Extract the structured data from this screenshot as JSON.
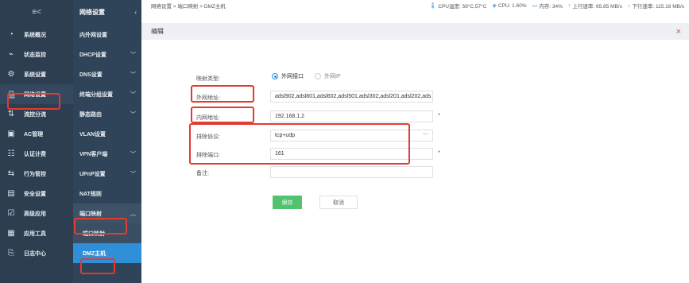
{
  "sidebar": {
    "collapse_icon": "≡<",
    "items": [
      {
        "icon": "dashboard-icon",
        "glyph": "◔",
        "label": "系统概况"
      },
      {
        "icon": "monitor-icon",
        "glyph": "⌁",
        "label": "状态监控"
      },
      {
        "icon": "gear-icon",
        "glyph": "⚙",
        "label": "系统设置"
      },
      {
        "icon": "network-icon",
        "glyph": "品",
        "label": "网络设置"
      },
      {
        "icon": "traffic-split-icon",
        "glyph": "⇅",
        "label": "流控分流"
      },
      {
        "icon": "ac-icon",
        "glyph": "▣",
        "label": "AC管理"
      },
      {
        "icon": "auth-icon",
        "glyph": "☷",
        "label": "认证计费"
      },
      {
        "icon": "behavior-icon",
        "glyph": "⇆",
        "label": "行为管控"
      },
      {
        "icon": "security-icon",
        "glyph": "▤",
        "label": "安全设置"
      },
      {
        "icon": "advanced-icon",
        "glyph": "☑",
        "label": "高级应用"
      },
      {
        "icon": "tools-icon",
        "glyph": "▦",
        "label": "应用工具"
      },
      {
        "icon": "log-icon",
        "glyph": "⎘",
        "label": "日志中心"
      }
    ]
  },
  "subbar": {
    "title": "网络设置",
    "items": [
      {
        "label": "内外网设置",
        "chevron": ""
      },
      {
        "label": "DHCP设置",
        "chevron": "﹀"
      },
      {
        "label": "DNS设置",
        "chevron": "﹀"
      },
      {
        "label": "终端分组设置",
        "chevron": "﹀"
      },
      {
        "label": "静态路由",
        "chevron": "﹀"
      },
      {
        "label": "VLAN设置",
        "chevron": ""
      },
      {
        "label": "VPN客户端",
        "chevron": "﹀"
      },
      {
        "label": "UPnP设置",
        "chevron": "﹀"
      },
      {
        "label": "NAT规则",
        "chevron": ""
      },
      {
        "label": "端口映射",
        "chevron": "︿"
      }
    ],
    "children": [
      {
        "label": "端口映射"
      },
      {
        "label": "DMZ主机"
      }
    ]
  },
  "topbar": {
    "breadcrumb": "网络设置 > 端口映射 > DMZ主机",
    "cpu_temp": "CPU温度: 59°C,57°C",
    "cpu": "CPU: 1.60%",
    "memory": "内存: 34%",
    "upload": "上行速率: 65.85 MB/s",
    "download": "下行速率: 115.16 MB/s"
  },
  "edit": {
    "title": "编辑",
    "close": "×"
  },
  "form": {
    "mapping_type_label": "映射类型:",
    "radio_wan": "外网接口",
    "radio_ip": "外网IP",
    "wan_addr_label": "外网地址:",
    "wan_addr_value": "adsl902,adsl801,adsl602,adsl501,adsl302,adsl201,adsl202,ads",
    "lan_addr_label": "内网地址:",
    "lan_addr_value": "192.168.1.2",
    "protocol_label": "排除协议:",
    "protocol_value": "tcp+udp",
    "port_label": "排除端口:",
    "port_value": "161",
    "remark_label": "备注:",
    "remark_value": "",
    "required_mark": "*",
    "save": "保存",
    "cancel": "取消"
  }
}
